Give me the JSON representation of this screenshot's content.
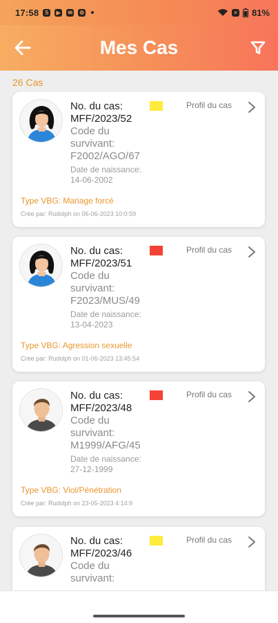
{
  "status_bar": {
    "time": "17:58",
    "battery": "81%",
    "icons": [
      "skype-icon",
      "youtube-icon",
      "mail-icon",
      "settings-icon",
      "dot-icon",
      "wifi-icon",
      "sim-icon",
      "battery-icon"
    ]
  },
  "header": {
    "title": "Mes Cas",
    "back_icon": "arrow-left-icon",
    "filter_icon": "filter-icon"
  },
  "case_count": "26 Cas",
  "colors": {
    "header_start": "#f7ad62",
    "header_end": "#f8745b",
    "accent_orange": "#e8962e",
    "flag_yellow": "#ffeb3b",
    "flag_red": "#f44336"
  },
  "cases": [
    {
      "avatar": "female",
      "flag": "yellow",
      "case_label": "No. du cas:",
      "case_no": "MFF/2023/52",
      "code_label_1": "Code du",
      "code_label_2": "survivant:",
      "code_value": "F2002/AGO/67",
      "dob_label": "Date de naissance:",
      "dob_value": "14-06-2002",
      "profile_label": "Profil du cas",
      "vbg": "Type VBG: Mariage forcé",
      "created": "Crée par: Rudolph on 06-06-2023 10:0:59"
    },
    {
      "avatar": "female",
      "flag": "red",
      "case_label": "No. du cas:",
      "case_no": "MFF/2023/51",
      "code_label_1": "Code du",
      "code_label_2": "survivant:",
      "code_value": "F2023/MUS/49",
      "dob_label": "Date de naissance:",
      "dob_value": "13-04-2023",
      "profile_label": "Profil du cas",
      "vbg": "Type VBG: Agression sexuelle",
      "created": "Crée par: Rudolph on 01-06-2023 13:45:54"
    },
    {
      "avatar": "male",
      "flag": "red",
      "case_label": "No. du cas:",
      "case_no": "MFF/2023/48",
      "code_label_1": "Code du",
      "code_label_2": "survivant:",
      "code_value": "M1999/AFG/45",
      "dob_label": "Date de naissance:",
      "dob_value": "27-12-1999",
      "profile_label": "Profil du cas",
      "vbg": "Type VBG: Viol/Pénétration",
      "created": "Crée par: Rudolph on 23-05-2023 4:14:9"
    },
    {
      "avatar": "male",
      "flag": "yellow",
      "case_label": "No. du cas:",
      "case_no": "MFF/2023/46",
      "code_label_1": "Code du",
      "code_label_2": "survivant:",
      "code_value": "",
      "dob_label": "",
      "dob_value": "",
      "profile_label": "Profil du cas",
      "vbg": "",
      "created": ""
    }
  ]
}
